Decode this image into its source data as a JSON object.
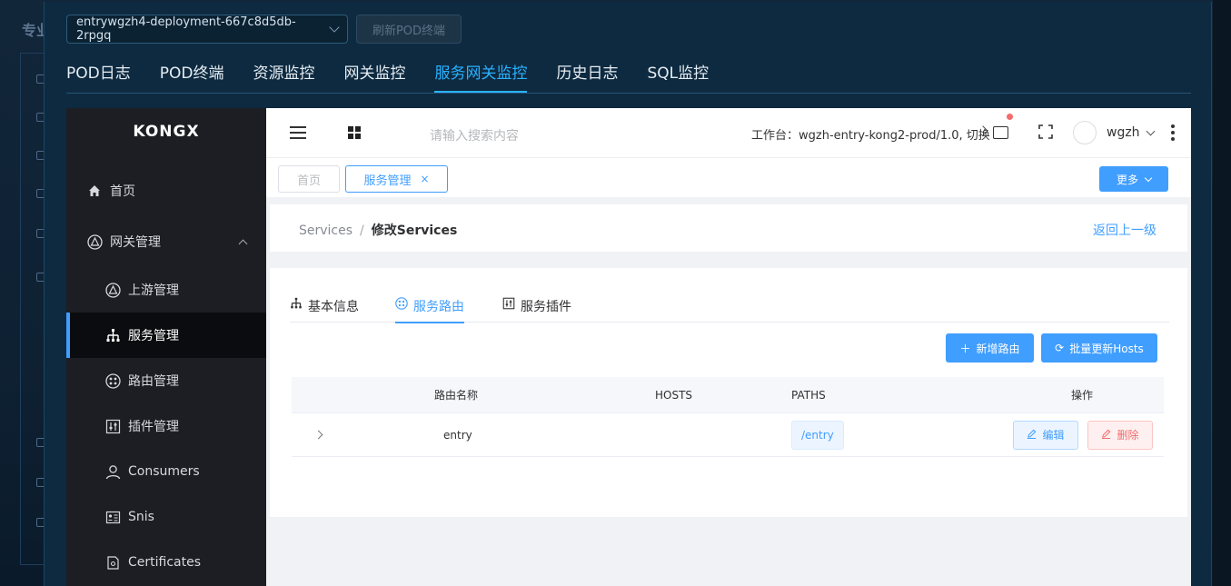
{
  "backdrop": {
    "title": "专业"
  },
  "pod": {
    "selected": "entrywgzh4-deployment-667c8d5db-2rpgq",
    "refresh_label": "刷新POD终端"
  },
  "tabs": [
    {
      "label": "POD日志"
    },
    {
      "label": "POD终端"
    },
    {
      "label": "资源监控"
    },
    {
      "label": "网关监控"
    },
    {
      "label": "服务网关监控",
      "active": true
    },
    {
      "label": "历史日志"
    },
    {
      "label": "SQL监控"
    }
  ],
  "app": {
    "logo": "KONGX",
    "menu": {
      "home": "首页",
      "gateway": "网关管理",
      "upstream": "上游管理",
      "services": "服务管理",
      "routes": "路由管理",
      "plugins": "插件管理",
      "consumers": "Consumers",
      "snis": "Snis",
      "certificates": "Certificates"
    },
    "topbar": {
      "search_placeholder": "请输入搜索内容",
      "workspace": "工作台：wgzh-entry-kong2-prod/1.0, 切换",
      "user": "wgzh"
    },
    "tagbar": {
      "tags": [
        "首页",
        "服务管理"
      ],
      "more_label": "更多"
    },
    "breadcrumb": {
      "parent": "Services",
      "separator": "/",
      "current": "修改Services",
      "back": "返回上一级"
    },
    "detail_tabs": [
      "基本信息",
      "服务路由",
      "服务插件"
    ],
    "actions": {
      "add_route": "新增路由",
      "batch_update": "批量更新Hosts"
    },
    "table": {
      "headers": [
        "路由名称",
        "HOSTS",
        "PATHS",
        "操作"
      ],
      "rows": [
        {
          "name": "entry",
          "hosts": "",
          "paths": "/entry",
          "edit": "编辑",
          "delete": "删除"
        }
      ]
    },
    "colors": {
      "primary": "#409eff",
      "danger": "#f56c6c",
      "sidebar": "#1d1e23",
      "modal": "#0d2a40",
      "tab_active": "#2ab1ff"
    }
  }
}
